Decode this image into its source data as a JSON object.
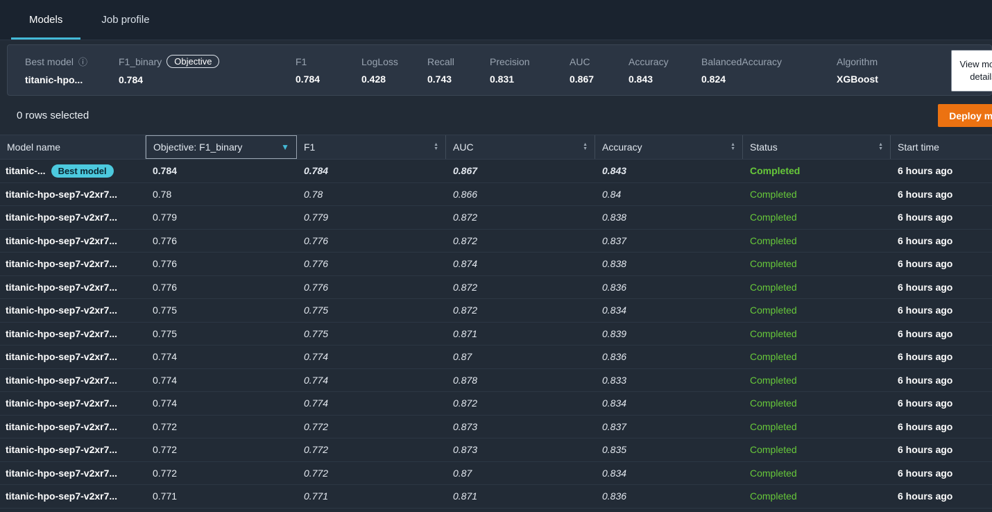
{
  "tabs": [
    {
      "label": "Models",
      "active": true
    },
    {
      "label": "Job profile",
      "active": false
    }
  ],
  "best_model_bar": {
    "metrics": [
      {
        "label": "Best model",
        "info_icon": true,
        "value": "titanic-hpo..."
      },
      {
        "label": "F1_binary",
        "badge": "Objective",
        "value": "0.784"
      },
      {
        "label": "F1",
        "value": "0.784"
      },
      {
        "label": "LogLoss",
        "value": "0.428"
      },
      {
        "label": "Recall",
        "value": "0.743"
      },
      {
        "label": "Precision",
        "value": "0.831"
      },
      {
        "label": "AUC",
        "value": "0.867"
      },
      {
        "label": "Accuracy",
        "value": "0.843"
      },
      {
        "label": "BalancedAccuracy",
        "value": "0.824"
      },
      {
        "label": "Algorithm",
        "value": "XGBoost"
      }
    ],
    "view_details_button": "View model details"
  },
  "selection_bar": {
    "rows_selected": "0 rows selected",
    "deploy_button": "Deploy model"
  },
  "table": {
    "columns": [
      {
        "label": "Model name",
        "sort": "none"
      },
      {
        "label": "Objective: F1_binary",
        "sort": "sorted"
      },
      {
        "label": "F1",
        "sort": "sortable"
      },
      {
        "label": "AUC",
        "sort": "sortable"
      },
      {
        "label": "Accuracy",
        "sort": "sortable"
      },
      {
        "label": "Status",
        "sort": "sortable"
      },
      {
        "label": "Start time",
        "sort": "none"
      }
    ],
    "rows": [
      {
        "name": "titanic-...",
        "badge": "Best model",
        "best": true,
        "objective": "0.784",
        "f1": "0.784",
        "auc": "0.867",
        "accuracy": "0.843",
        "status": "Completed",
        "start_time": "6 hours ago"
      },
      {
        "name": "titanic-hpo-sep7-v2xr7...",
        "objective": "0.78",
        "f1": "0.78",
        "auc": "0.866",
        "accuracy": "0.84",
        "status": "Completed",
        "start_time": "6 hours ago"
      },
      {
        "name": "titanic-hpo-sep7-v2xr7...",
        "objective": "0.779",
        "f1": "0.779",
        "auc": "0.872",
        "accuracy": "0.838",
        "status": "Completed",
        "start_time": "6 hours ago"
      },
      {
        "name": "titanic-hpo-sep7-v2xr7...",
        "objective": "0.776",
        "f1": "0.776",
        "auc": "0.872",
        "accuracy": "0.837",
        "status": "Completed",
        "start_time": "6 hours ago"
      },
      {
        "name": "titanic-hpo-sep7-v2xr7...",
        "objective": "0.776",
        "f1": "0.776",
        "auc": "0.874",
        "accuracy": "0.838",
        "status": "Completed",
        "start_time": "6 hours ago"
      },
      {
        "name": "titanic-hpo-sep7-v2xr7...",
        "objective": "0.776",
        "f1": "0.776",
        "auc": "0.872",
        "accuracy": "0.836",
        "status": "Completed",
        "start_time": "6 hours ago"
      },
      {
        "name": "titanic-hpo-sep7-v2xr7...",
        "objective": "0.775",
        "f1": "0.775",
        "auc": "0.872",
        "accuracy": "0.834",
        "status": "Completed",
        "start_time": "6 hours ago"
      },
      {
        "name": "titanic-hpo-sep7-v2xr7...",
        "objective": "0.775",
        "f1": "0.775",
        "auc": "0.871",
        "accuracy": "0.839",
        "status": "Completed",
        "start_time": "6 hours ago"
      },
      {
        "name": "titanic-hpo-sep7-v2xr7...",
        "objective": "0.774",
        "f1": "0.774",
        "auc": "0.87",
        "accuracy": "0.836",
        "status": "Completed",
        "start_time": "6 hours ago"
      },
      {
        "name": "titanic-hpo-sep7-v2xr7...",
        "objective": "0.774",
        "f1": "0.774",
        "auc": "0.878",
        "accuracy": "0.833",
        "status": "Completed",
        "start_time": "6 hours ago"
      },
      {
        "name": "titanic-hpo-sep7-v2xr7...",
        "objective": "0.774",
        "f1": "0.774",
        "auc": "0.872",
        "accuracy": "0.834",
        "status": "Completed",
        "start_time": "6 hours ago"
      },
      {
        "name": "titanic-hpo-sep7-v2xr7...",
        "objective": "0.772",
        "f1": "0.772",
        "auc": "0.873",
        "accuracy": "0.837",
        "status": "Completed",
        "start_time": "6 hours ago"
      },
      {
        "name": "titanic-hpo-sep7-v2xr7...",
        "objective": "0.772",
        "f1": "0.772",
        "auc": "0.873",
        "accuracy": "0.835",
        "status": "Completed",
        "start_time": "6 hours ago"
      },
      {
        "name": "titanic-hpo-sep7-v2xr7...",
        "objective": "0.772",
        "f1": "0.772",
        "auc": "0.87",
        "accuracy": "0.834",
        "status": "Completed",
        "start_time": "6 hours ago"
      },
      {
        "name": "titanic-hpo-sep7-v2xr7...",
        "objective": "0.771",
        "f1": "0.771",
        "auc": "0.871",
        "accuracy": "0.836",
        "status": "Completed",
        "start_time": "6 hours ago"
      }
    ]
  },
  "colors": {
    "accent_blue": "#44b9d6",
    "success_green": "#67c83a",
    "deploy_orange": "#ec7211",
    "best_badge_cyan": "#4cc9de"
  }
}
